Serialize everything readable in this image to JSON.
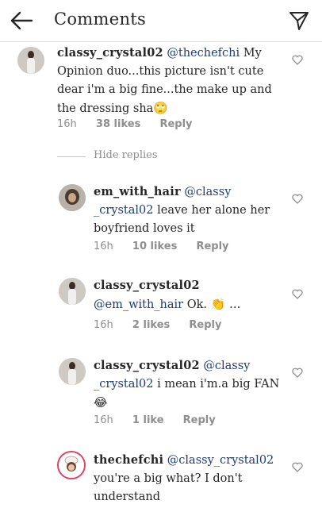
{
  "header": {
    "title": "Comments",
    "back_icon": "arrow-left-icon",
    "send_icon": "paper-plane-icon"
  },
  "comments": [
    {
      "username": "classy_crystal02",
      "mention": "@thechefchi",
      "text": " My Opinion duo...this picture isn't cute dear i'm a big fine...the make up and the dressing sha",
      "emoji": "🙄",
      "time": "16h",
      "likes": "38 likes",
      "reply": "Reply"
    },
    {
      "username": "em_with_hair",
      "mention": "@classy _crystal02",
      "text": " leave her alone her boyfriend loves it",
      "emoji": "",
      "time": "16h",
      "likes": "10 likes",
      "reply": "Reply"
    },
    {
      "username": "classy_crystal02",
      "mention": "@em_with_hair",
      "text": " Ok.",
      "emoji": "👏 ...",
      "time": "16h",
      "likes": "2 likes",
      "reply": "Reply"
    },
    {
      "username": "classy_crystal02",
      "mention": "@classy _crystal02",
      "text": " i mean i'm.a big FAN",
      "emoji": "😂",
      "time": "16h",
      "likes": "1 like",
      "reply": "Reply"
    },
    {
      "username": "thechefchi",
      "mention": "@classy_crystal02",
      "text": " you're a big what? I don't understand",
      "emoji": "",
      "time": "",
      "likes": "",
      "reply": ""
    }
  ],
  "hide_replies_label": "Hide replies",
  "colors": {
    "mention": "#1f3b72",
    "meta": "#8e8e8e",
    "story_ring": "#e4405f"
  }
}
